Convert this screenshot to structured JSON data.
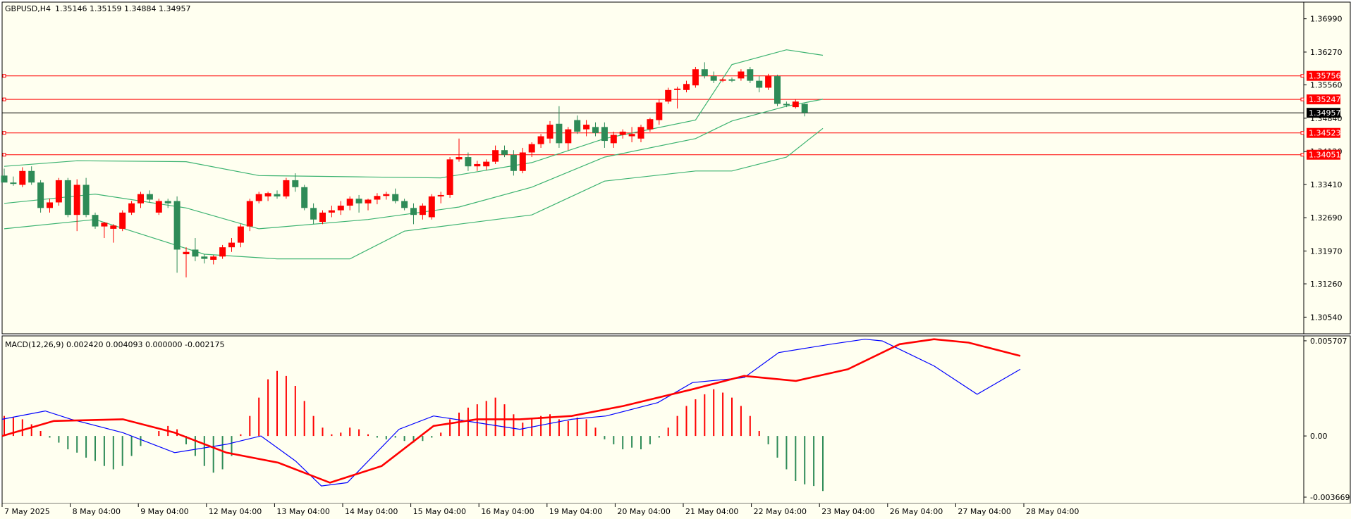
{
  "symbol_info": {
    "header": "GBPUSD,H4",
    "ohlc": "1.35146 1.35159 1.34884 1.34957"
  },
  "macd_info": {
    "header": "MACD(12,26,9) 0.002420 0.004093 0.000000 -0.002175"
  },
  "colors": {
    "background": "#fffff0",
    "bull": "#ff0000",
    "bear": "#2e8b57",
    "bands": "#3cb371",
    "hline": "#ff0000",
    "price_line": "#000000",
    "macd_line": "#0000ff",
    "signal_line": "#ff0000"
  },
  "chart_data": [
    {
      "type": "candlestick",
      "title": "GBPUSD,H4",
      "ylim": [
        1.3018,
        1.3735
      ],
      "price_ticks": [
        "1.36990",
        "1.36270",
        "1.35560",
        "1.34840",
        "1.34120",
        "1.33410",
        "1.32690",
        "1.31970",
        "1.31260",
        "1.30540"
      ],
      "x_labels": [
        "7 May 2025",
        "8 May 04:00",
        "9 May 04:00",
        "12 May 04:00",
        "13 May 04:00",
        "14 May 04:00",
        "15 May 04:00",
        "16 May 04:00",
        "19 May 04:00",
        "20 May 04:00",
        "21 May 04:00",
        "22 May 04:00",
        "23 May 04:00",
        "26 May 04:00",
        "27 May 04:00",
        "28 May 04:00"
      ],
      "candles": [
        {
          "o": 1.336,
          "h": 1.3375,
          "l": 1.335,
          "c": 1.3345
        },
        {
          "o": 1.3345,
          "h": 1.3358,
          "l": 1.3338,
          "c": 1.3342
        },
        {
          "o": 1.334,
          "h": 1.3378,
          "l": 1.3335,
          "c": 1.337
        },
        {
          "o": 1.337,
          "h": 1.338,
          "l": 1.334,
          "c": 1.3345
        },
        {
          "o": 1.3345,
          "h": 1.335,
          "l": 1.328,
          "c": 1.329
        },
        {
          "o": 1.329,
          "h": 1.331,
          "l": 1.328,
          "c": 1.3302
        },
        {
          "o": 1.3302,
          "h": 1.3355,
          "l": 1.3295,
          "c": 1.335
        },
        {
          "o": 1.335,
          "h": 1.3355,
          "l": 1.327,
          "c": 1.3275
        },
        {
          "o": 1.3275,
          "h": 1.3352,
          "l": 1.324,
          "c": 1.334
        },
        {
          "o": 1.334,
          "h": 1.3355,
          "l": 1.327,
          "c": 1.3275
        },
        {
          "o": 1.3275,
          "h": 1.328,
          "l": 1.3245,
          "c": 1.325
        },
        {
          "o": 1.325,
          "h": 1.326,
          "l": 1.3225,
          "c": 1.3258
        },
        {
          "o": 1.3245,
          "h": 1.3255,
          "l": 1.3215,
          "c": 1.3252
        },
        {
          "o": 1.3245,
          "h": 1.3285,
          "l": 1.324,
          "c": 1.328
        },
        {
          "o": 1.328,
          "h": 1.3305,
          "l": 1.3275,
          "c": 1.33
        },
        {
          "o": 1.33,
          "h": 1.3325,
          "l": 1.329,
          "c": 1.332
        },
        {
          "o": 1.332,
          "h": 1.3328,
          "l": 1.3302,
          "c": 1.3308
        },
        {
          "o": 1.328,
          "h": 1.331,
          "l": 1.3275,
          "c": 1.3305
        },
        {
          "o": 1.3305,
          "h": 1.331,
          "l": 1.329,
          "c": 1.33
        },
        {
          "o": 1.3305,
          "h": 1.3315,
          "l": 1.315,
          "c": 1.32
        },
        {
          "o": 1.319,
          "h": 1.3205,
          "l": 1.314,
          "c": 1.3195
        },
        {
          "o": 1.32,
          "h": 1.3225,
          "l": 1.3175,
          "c": 1.3185
        },
        {
          "o": 1.3185,
          "h": 1.319,
          "l": 1.317,
          "c": 1.318
        },
        {
          "o": 1.3178,
          "h": 1.3188,
          "l": 1.3168,
          "c": 1.3185
        },
        {
          "o": 1.3185,
          "h": 1.321,
          "l": 1.318,
          "c": 1.3205
        },
        {
          "o": 1.3205,
          "h": 1.3225,
          "l": 1.3195,
          "c": 1.3215
        },
        {
          "o": 1.3215,
          "h": 1.3255,
          "l": 1.3205,
          "c": 1.325
        },
        {
          "o": 1.325,
          "h": 1.331,
          "l": 1.324,
          "c": 1.3305
        },
        {
          "o": 1.3305,
          "h": 1.3325,
          "l": 1.33,
          "c": 1.332
        },
        {
          "o": 1.3315,
          "h": 1.3325,
          "l": 1.3305,
          "c": 1.3322
        },
        {
          "o": 1.332,
          "h": 1.3328,
          "l": 1.331,
          "c": 1.3315
        },
        {
          "o": 1.3315,
          "h": 1.3355,
          "l": 1.331,
          "c": 1.335
        },
        {
          "o": 1.335,
          "h": 1.3365,
          "l": 1.3325,
          "c": 1.3335
        },
        {
          "o": 1.3335,
          "h": 1.334,
          "l": 1.3285,
          "c": 1.329
        },
        {
          "o": 1.329,
          "h": 1.33,
          "l": 1.3255,
          "c": 1.3265
        },
        {
          "o": 1.326,
          "h": 1.3285,
          "l": 1.3255,
          "c": 1.328
        },
        {
          "o": 1.328,
          "h": 1.3295,
          "l": 1.327,
          "c": 1.3285
        },
        {
          "o": 1.3285,
          "h": 1.3305,
          "l": 1.3275,
          "c": 1.3295
        },
        {
          "o": 1.3295,
          "h": 1.3315,
          "l": 1.3285,
          "c": 1.331
        },
        {
          "o": 1.331,
          "h": 1.3318,
          "l": 1.328,
          "c": 1.33
        },
        {
          "o": 1.33,
          "h": 1.331,
          "l": 1.3285,
          "c": 1.3308
        },
        {
          "o": 1.3308,
          "h": 1.3322,
          "l": 1.3298,
          "c": 1.3316
        },
        {
          "o": 1.3316,
          "h": 1.3325,
          "l": 1.3308,
          "c": 1.332
        },
        {
          "o": 1.332,
          "h": 1.3332,
          "l": 1.33,
          "c": 1.3305
        },
        {
          "o": 1.3305,
          "h": 1.331,
          "l": 1.3285,
          "c": 1.329
        },
        {
          "o": 1.329,
          "h": 1.33,
          "l": 1.3255,
          "c": 1.3275
        },
        {
          "o": 1.3275,
          "h": 1.33,
          "l": 1.3265,
          "c": 1.3295
        },
        {
          "o": 1.327,
          "h": 1.332,
          "l": 1.3265,
          "c": 1.3315
        },
        {
          "o": 1.3315,
          "h": 1.3325,
          "l": 1.33,
          "c": 1.3318
        },
        {
          "o": 1.3318,
          "h": 1.34,
          "l": 1.3312,
          "c": 1.3395
        },
        {
          "o": 1.3395,
          "h": 1.344,
          "l": 1.339,
          "c": 1.34
        },
        {
          "o": 1.34,
          "h": 1.341,
          "l": 1.337,
          "c": 1.338
        },
        {
          "o": 1.338,
          "h": 1.3392,
          "l": 1.337,
          "c": 1.3385
        },
        {
          "o": 1.338,
          "h": 1.3395,
          "l": 1.3372,
          "c": 1.339
        },
        {
          "o": 1.339,
          "h": 1.3425,
          "l": 1.3385,
          "c": 1.3415
        },
        {
          "o": 1.3415,
          "h": 1.3425,
          "l": 1.34,
          "c": 1.3405
        },
        {
          "o": 1.3405,
          "h": 1.3415,
          "l": 1.336,
          "c": 1.337
        },
        {
          "o": 1.337,
          "h": 1.342,
          "l": 1.3365,
          "c": 1.341
        },
        {
          "o": 1.341,
          "h": 1.3432,
          "l": 1.34,
          "c": 1.3428
        },
        {
          "o": 1.3428,
          "h": 1.345,
          "l": 1.342,
          "c": 1.3445
        },
        {
          "o": 1.344,
          "h": 1.3478,
          "l": 1.343,
          "c": 1.347
        },
        {
          "o": 1.3472,
          "h": 1.351,
          "l": 1.342,
          "c": 1.343
        },
        {
          "o": 1.343,
          "h": 1.3465,
          "l": 1.3415,
          "c": 1.346
        },
        {
          "o": 1.348,
          "h": 1.349,
          "l": 1.345,
          "c": 1.3455
        },
        {
          "o": 1.346,
          "h": 1.348,
          "l": 1.3445,
          "c": 1.347
        },
        {
          "o": 1.3465,
          "h": 1.3475,
          "l": 1.3445,
          "c": 1.3452
        },
        {
          "o": 1.3465,
          "h": 1.3475,
          "l": 1.342,
          "c": 1.3435
        },
        {
          "o": 1.343,
          "h": 1.3455,
          "l": 1.342,
          "c": 1.3448
        },
        {
          "o": 1.3448,
          "h": 1.346,
          "l": 1.344,
          "c": 1.3455
        },
        {
          "o": 1.3445,
          "h": 1.3465,
          "l": 1.3432,
          "c": 1.345
        },
        {
          "o": 1.344,
          "h": 1.347,
          "l": 1.3432,
          "c": 1.3465
        },
        {
          "o": 1.346,
          "h": 1.3485,
          "l": 1.3455,
          "c": 1.3482
        },
        {
          "o": 1.348,
          "h": 1.3525,
          "l": 1.347,
          "c": 1.3518
        },
        {
          "o": 1.352,
          "h": 1.355,
          "l": 1.3515,
          "c": 1.3545
        },
        {
          "o": 1.3545,
          "h": 1.3552,
          "l": 1.3505,
          "c": 1.3548
        },
        {
          "o": 1.3545,
          "h": 1.3565,
          "l": 1.354,
          "c": 1.3558
        },
        {
          "o": 1.3555,
          "h": 1.3595,
          "l": 1.355,
          "c": 1.359
        },
        {
          "o": 1.359,
          "h": 1.3605,
          "l": 1.357,
          "c": 1.3575
        },
        {
          "o": 1.3575,
          "h": 1.3585,
          "l": 1.356,
          "c": 1.3565
        },
        {
          "o": 1.3565,
          "h": 1.3572,
          "l": 1.3562,
          "c": 1.3568
        },
        {
          "o": 1.3568,
          "h": 1.3572,
          "l": 1.3562,
          "c": 1.3565
        },
        {
          "o": 1.357,
          "h": 1.359,
          "l": 1.3565,
          "c": 1.3585
        },
        {
          "o": 1.359,
          "h": 1.3595,
          "l": 1.356,
          "c": 1.3565
        },
        {
          "o": 1.3565,
          "h": 1.3575,
          "l": 1.354,
          "c": 1.355
        },
        {
          "o": 1.355,
          "h": 1.358,
          "l": 1.3545,
          "c": 1.3575
        },
        {
          "o": 1.3575,
          "h": 1.3578,
          "l": 1.351,
          "c": 1.3515
        },
        {
          "o": 1.3515,
          "h": 1.352,
          "l": 1.3508,
          "c": 1.3512
        },
        {
          "o": 1.3508,
          "h": 1.3525,
          "l": 1.3505,
          "c": 1.352
        },
        {
          "o": 1.3515,
          "h": 1.3516,
          "l": 1.3488,
          "c": 1.3496
        }
      ],
      "bollinger": {
        "upper": [
          [
            0,
            1.338
          ],
          [
            8,
            1.3392
          ],
          [
            20,
            1.339
          ],
          [
            28,
            1.336
          ],
          [
            40,
            1.3357
          ],
          [
            48,
            1.3355
          ],
          [
            58,
            1.3388
          ],
          [
            66,
            1.344
          ],
          [
            76,
            1.348
          ],
          [
            80,
            1.36
          ],
          [
            86,
            1.3632
          ],
          [
            90,
            1.362
          ]
        ],
        "middle": [
          [
            0,
            1.33
          ],
          [
            10,
            1.332
          ],
          [
            20,
            1.329
          ],
          [
            28,
            1.3245
          ],
          [
            40,
            1.3265
          ],
          [
            50,
            1.3292
          ],
          [
            58,
            1.3335
          ],
          [
            66,
            1.34
          ],
          [
            76,
            1.344
          ],
          [
            80,
            1.3478
          ],
          [
            86,
            1.351
          ],
          [
            90,
            1.3525
          ]
        ],
        "lower": [
          [
            0,
            1.3245
          ],
          [
            10,
            1.3265
          ],
          [
            22,
            1.319
          ],
          [
            30,
            1.318
          ],
          [
            38,
            1.318
          ],
          [
            44,
            1.324
          ],
          [
            50,
            1.3255
          ],
          [
            58,
            1.3275
          ],
          [
            66,
            1.3348
          ],
          [
            76,
            1.337
          ],
          [
            80,
            1.337
          ],
          [
            86,
            1.34
          ],
          [
            90,
            1.3462
          ]
        ]
      },
      "horizontal_lines": [
        {
          "value": 1.35756,
          "label": "1.35756"
        },
        {
          "value": 1.35247,
          "label": "1.35247"
        },
        {
          "value": 1.34523,
          "label": "1.34523"
        },
        {
          "value": 1.34051,
          "label": "1.34051"
        }
      ],
      "current_price": {
        "value": 1.34957,
        "label": "1.34957"
      }
    },
    {
      "type": "macd",
      "title": "MACD(12,26,9)",
      "ylim": [
        -0.00405,
        0.006
      ],
      "ticks": [
        "0.005707",
        "0.00",
        "-0.003669"
      ],
      "histogram": [
        0.0012,
        0.0011,
        0.001,
        0.0007,
        0.0003,
        -0.0001,
        -0.0004,
        -0.0008,
        -0.001,
        -0.0013,
        -0.0015,
        -0.0018,
        -0.002,
        -0.0018,
        -0.0012,
        -0.0006,
        0.0,
        0.0003,
        0.0006,
        0.0004,
        -0.0005,
        -0.0012,
        -0.0018,
        -0.0022,
        -0.002,
        -0.0012,
        0.0001,
        0.0012,
        0.0023,
        0.0034,
        0.0039,
        0.0036,
        0.003,
        0.0021,
        0.0012,
        0.0005,
        0.0001,
        0.0002,
        0.0005,
        0.0004,
        0.0001,
        -0.0001,
        -0.0002,
        -0.0001,
        -0.0003,
        -0.0004,
        -0.0003,
        -0.0001,
        0.0002,
        0.001,
        0.0014,
        0.0017,
        0.0019,
        0.0021,
        0.0023,
        0.0019,
        0.0013,
        0.0008,
        0.001,
        0.0012,
        0.0013,
        0.001,
        0.0009,
        0.0011,
        0.001,
        0.0005,
        -0.0002,
        -0.0005,
        -0.0008,
        -0.0007,
        -0.0008,
        -0.0005,
        -0.0001,
        0.0005,
        0.0012,
        0.0018,
        0.0022,
        0.0025,
        0.0028,
        0.0026,
        0.0023,
        0.0018,
        0.0012,
        0.0003,
        -0.0005,
        -0.0013,
        -0.002,
        -0.0027,
        -0.0029,
        -0.003,
        -0.0033
      ],
      "macd": [
        [
          0,
          0.001
        ],
        [
          5,
          0.0015
        ],
        [
          8,
          0.001
        ],
        [
          14,
          0.0002
        ],
        [
          20,
          -0.001
        ],
        [
          26,
          -0.0005
        ],
        [
          30,
          0.0
        ],
        [
          34,
          -0.0015
        ],
        [
          37,
          -0.003
        ],
        [
          40,
          -0.0028
        ],
        [
          46,
          0.0004
        ],
        [
          50,
          0.0012
        ],
        [
          55,
          0.0008
        ],
        [
          60,
          0.0004
        ],
        [
          66,
          0.001
        ],
        [
          70,
          0.0012
        ],
        [
          76,
          0.002
        ],
        [
          80,
          0.0032
        ],
        [
          86,
          0.0035
        ],
        [
          90,
          0.005
        ],
        [
          96,
          0.0055
        ],
        [
          100,
          0.0058
        ],
        [
          102,
          0.0057
        ],
        [
          108,
          0.0042
        ],
        [
          113,
          0.0025
        ],
        [
          118,
          0.004
        ]
      ],
      "signal": [
        [
          0,
          0.0
        ],
        [
          6,
          0.0009
        ],
        [
          14,
          0.001
        ],
        [
          20,
          0.0002
        ],
        [
          26,
          -0.001
        ],
        [
          32,
          -0.0016
        ],
        [
          38,
          -0.0028
        ],
        [
          44,
          -0.0018
        ],
        [
          50,
          0.0006
        ],
        [
          55,
          0.001
        ],
        [
          60,
          0.001
        ],
        [
          66,
          0.0012
        ],
        [
          72,
          0.0018
        ],
        [
          80,
          0.0028
        ],
        [
          86,
          0.0036
        ],
        [
          92,
          0.0033
        ],
        [
          98,
          0.004
        ],
        [
          104,
          0.0055
        ],
        [
          108,
          0.0058
        ],
        [
          112,
          0.0056
        ],
        [
          118,
          0.0048
        ]
      ]
    }
  ]
}
